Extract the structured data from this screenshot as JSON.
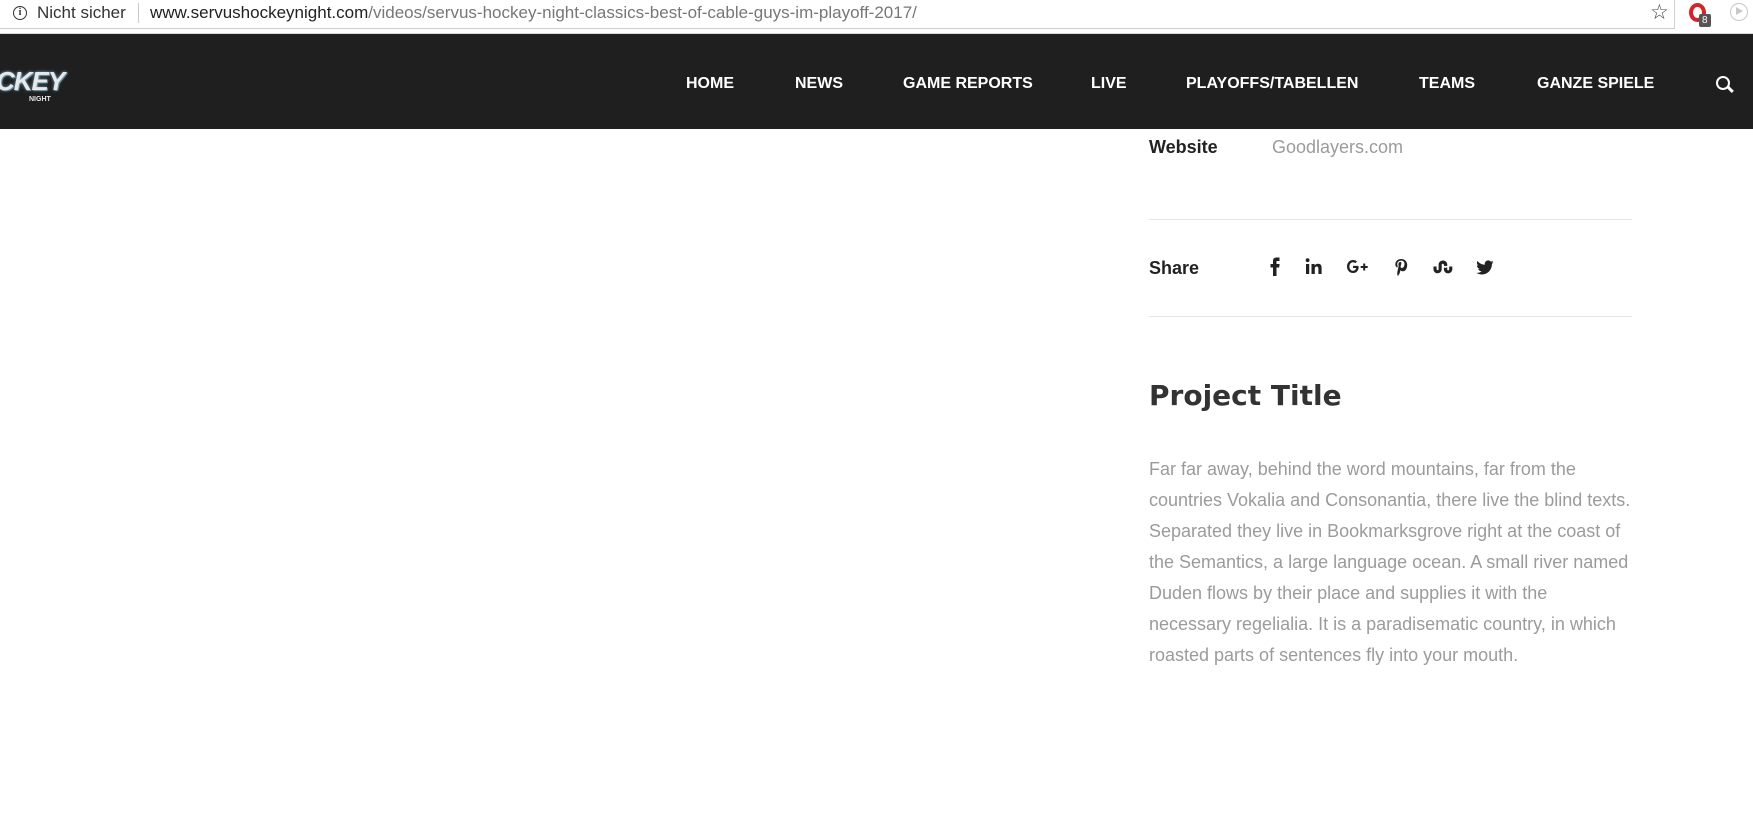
{
  "browser": {
    "security_label": "Nicht sicher",
    "url_host": "www.servushockeynight.com",
    "url_path": "/videos/servus-hockey-night-classics-best-of-cable-guys-im-playoff-2017/",
    "extension_badge": "8"
  },
  "header": {
    "logo_text": "CKEY",
    "logo_subtext": "NIGHT",
    "nav": [
      {
        "label": "HOME"
      },
      {
        "label": "NEWS"
      },
      {
        "label": "GAME REPORTS"
      },
      {
        "label": "LIVE"
      },
      {
        "label": "PLAYOFFS/TABELLEN"
      },
      {
        "label": "TEAMS"
      },
      {
        "label": "GANZE SPIELE"
      }
    ]
  },
  "project": {
    "website_label": "Website",
    "website_value": "Goodlayers.com",
    "share_label": "Share",
    "share_icons": [
      "facebook-icon",
      "linkedin-icon",
      "google-plus-icon",
      "pinterest-icon",
      "stumbleupon-icon",
      "twitter-icon"
    ],
    "title": "Project Title",
    "description": "Far far away, behind the word mountains, far from the countries Vokalia and Consonantia, there live the blind texts. Separated they live in Bookmarksgrove right at the coast of the Semantics, a large language ocean. A small river named Duden flows by their place and supplies it with the necessary regelialia. It is a paradisematic country, in which roasted parts of sentences fly into your mouth."
  },
  "colors": {
    "header_bg": "#1f1f1f",
    "muted_text": "#9b9b9b",
    "heading_text": "#333333"
  }
}
